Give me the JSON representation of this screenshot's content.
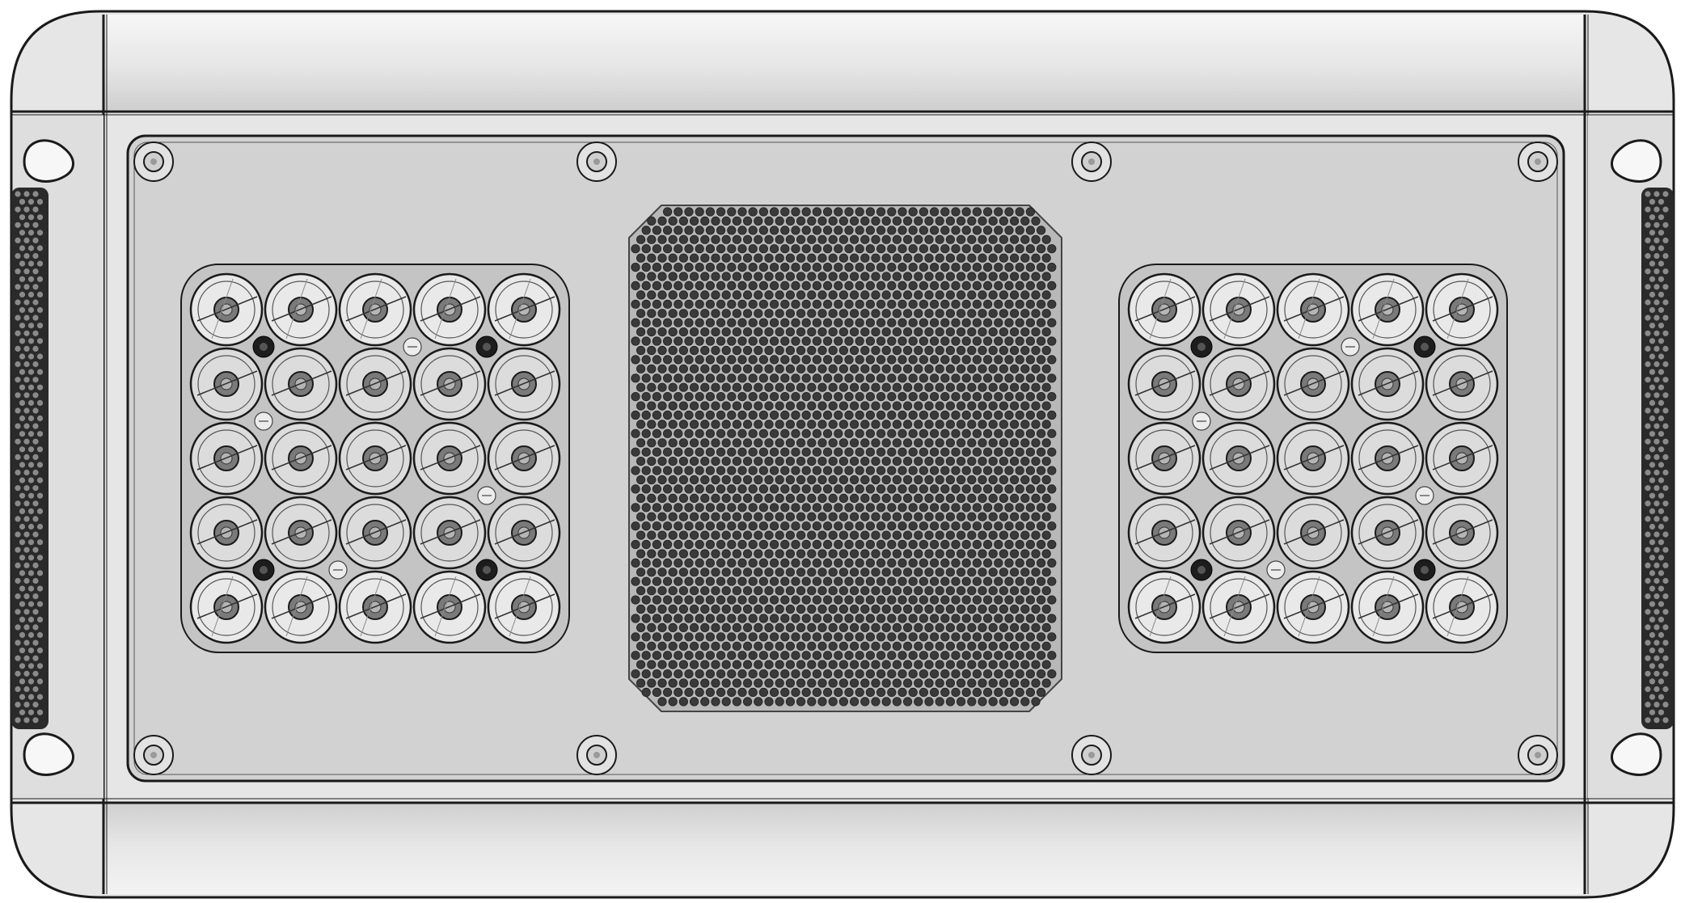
{
  "figure": {
    "subject": "led-fixture-front-view",
    "view": "front",
    "colors": {
      "outline": "#1a1a1a",
      "housing": "#e6e6e6",
      "housing_shade": "#cfcfcf",
      "panel": "#d2d2d2",
      "lens": "#e9e9e9",
      "lens_dim": "#dcdcdc",
      "led_core": "#7a7a7a",
      "grille_hole": "#3a3a3a",
      "background": "#ffffff"
    },
    "led_arrays": [
      {
        "id": "left",
        "rows": 5,
        "cols": 5,
        "lens_count": 25,
        "dark_mounts": 4,
        "light_mounts": 4
      },
      {
        "id": "right",
        "rows": 5,
        "cols": 5,
        "lens_count": 25,
        "dark_mounts": 4,
        "light_mounts": 4
      }
    ],
    "fan_grille": {
      "shape": "rounded-square",
      "hole_pattern": "staggered"
    },
    "panel_screws": 8,
    "side_vents": 2,
    "strap_loops": 4
  }
}
